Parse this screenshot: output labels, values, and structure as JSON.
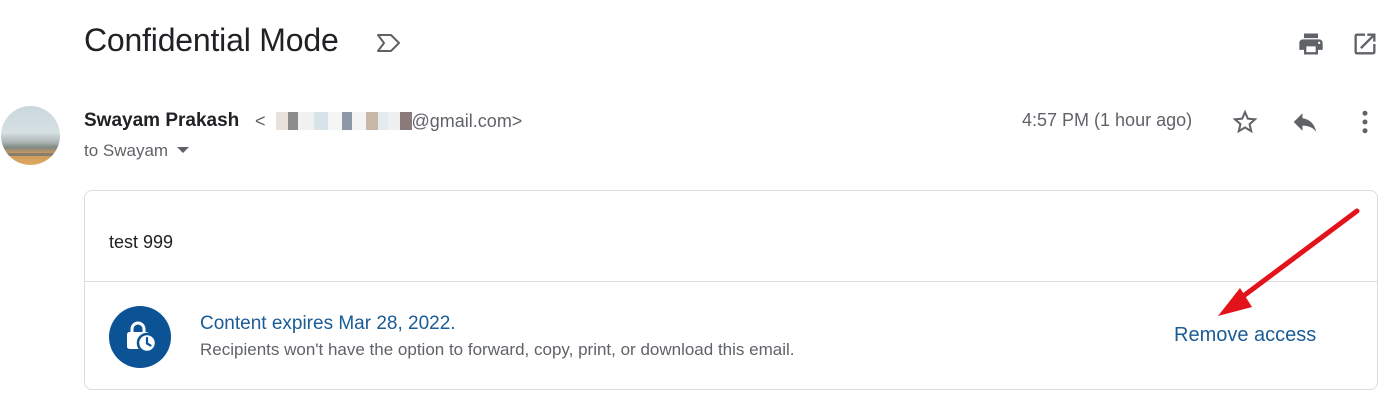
{
  "header": {
    "subject": "Confidential Mode",
    "icons": {
      "label": "label-outline-icon",
      "print": "print-icon",
      "open_new_window": "open-in-new-icon"
    }
  },
  "message": {
    "sender_name": "Swayam Prakash",
    "email_prefix": "<",
    "email_suffix": "@gmail.com>",
    "to_label": "to Swayam",
    "timestamp": "4:57 PM (1 hour ago)",
    "icons": {
      "star": "star-outline-icon",
      "reply": "reply-icon",
      "more": "more-vertical-icon",
      "recipients_toggle": "caret-down-icon"
    },
    "body": "test 999"
  },
  "confidential_notice": {
    "title": "Content expires Mar 28, 2022.",
    "description": "Recipients won't have the option to forward, copy, print, or download this email.",
    "action_label": "Remove access",
    "icon": "lock-clock-icon"
  },
  "colors": {
    "accent": "#1a5c95",
    "lock_badge": "#0b5394",
    "annotation_arrow": "#e3131b",
    "muted_text": "#5f6368",
    "border": "#dadce0"
  }
}
